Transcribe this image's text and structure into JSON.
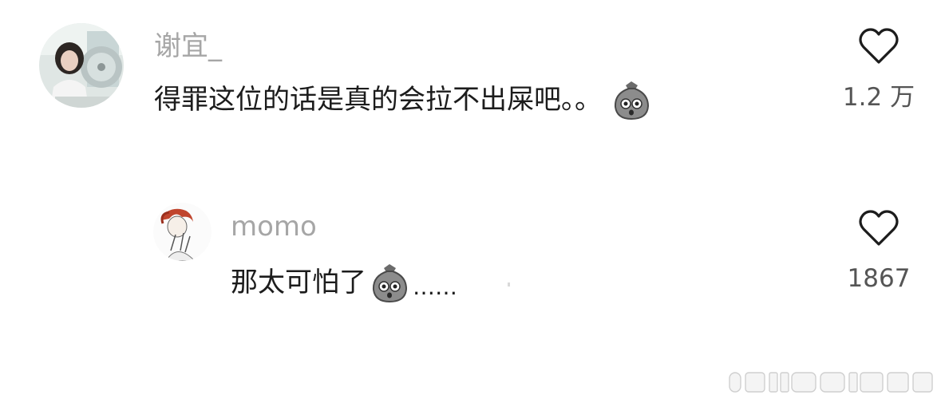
{
  "comments": [
    {
      "username": "谢宜_",
      "text": "得罪这位的话是真的会拉不出屎吧。。",
      "emoji": "shocked-sack-emoji",
      "likes": "1.2 万"
    },
    {
      "username": "momo",
      "text": "那太可怕了",
      "emoji": "shocked-sack-emoji",
      "trailing_text": "……",
      "likes": "1867"
    }
  ],
  "watermark": "",
  "colors": {
    "username": "#a6a6a6",
    "text": "#1c1c1c",
    "like": "#555555",
    "background": "#ffffff"
  }
}
